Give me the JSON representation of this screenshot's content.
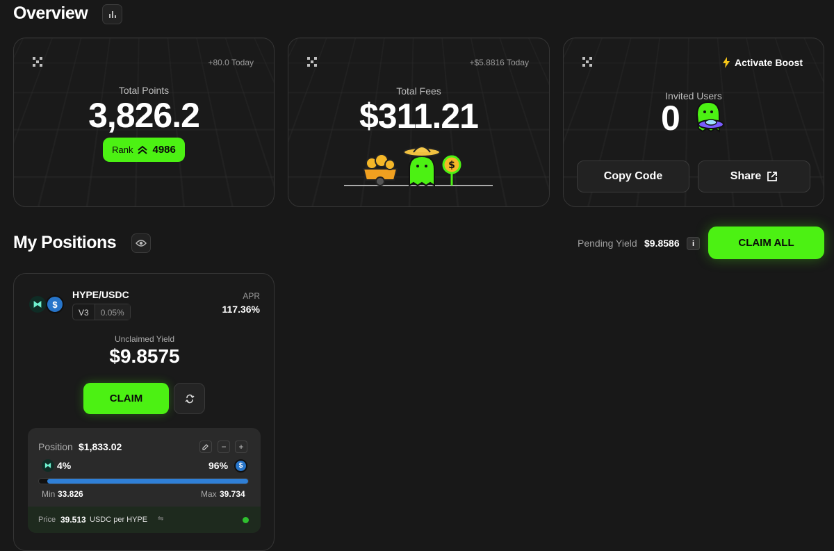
{
  "overview": {
    "title": "Overview",
    "points": {
      "today": "+80.0 Today",
      "label": "Total Points",
      "value": "3,826.2",
      "rank_label": "Rank",
      "rank_value": "4986"
    },
    "fees": {
      "today": "+$5.8816 Today",
      "label": "Total Fees",
      "value": "$311.21"
    },
    "invites": {
      "boost_label": "Activate Boost",
      "label": "Invited Users",
      "value": "0",
      "copy_label": "Copy Code",
      "share_label": "Share"
    }
  },
  "positions": {
    "title": "My Positions",
    "pending_label": "Pending Yield",
    "pending_value": "$9.8586",
    "info": "i",
    "claim_all": "CLAIM ALL"
  },
  "position_card": {
    "pair": "HYPE/USDC",
    "version": "V3",
    "fee": "0.05%",
    "apr_label": "APR",
    "apr_value": "117.36%",
    "unclaimed_label": "Unclaimed Yield",
    "unclaimed_value": "$9.8575",
    "claim": "CLAIM",
    "position_label": "Position",
    "position_value": "$1,833.02",
    "hype_pct": "4%",
    "usdc_pct": "96%",
    "range_fill": 0.96,
    "min_label": "Min",
    "min_value": "33.826",
    "max_label": "Max",
    "max_value": "39.734",
    "price_label": "Price",
    "price_value": "39.513",
    "price_unit": "USDC per HYPE",
    "in_range_color": "#2fbf2f"
  },
  "colors": {
    "accent": "#4cf113",
    "bar": "#2f7fd6"
  }
}
